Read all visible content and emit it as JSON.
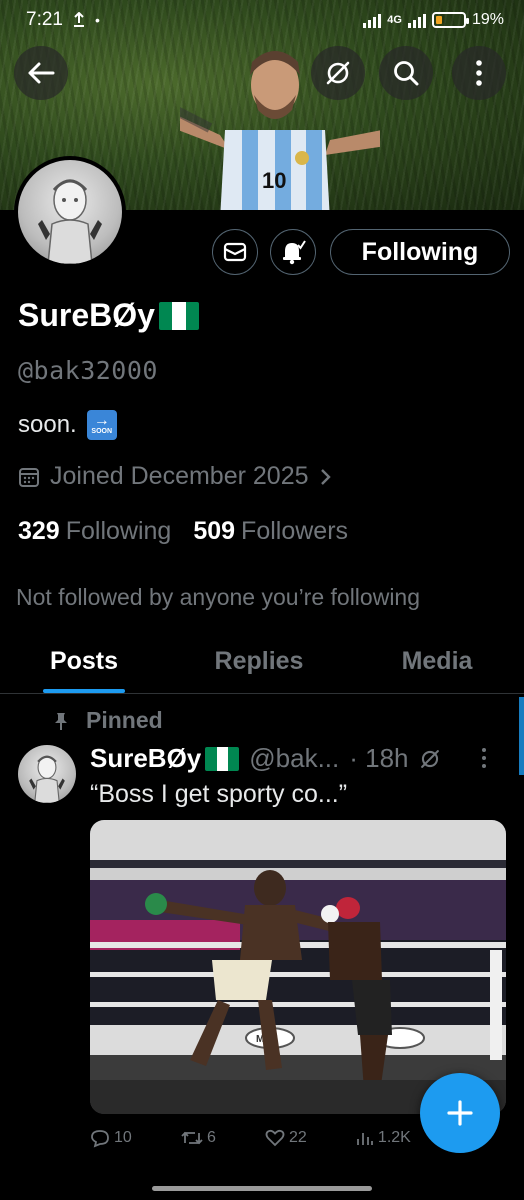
{
  "status_bar": {
    "time": "7:21",
    "network": "4G",
    "battery": "19%"
  },
  "profile": {
    "display_name": "SureBØy",
    "handle": "@bak32000",
    "bio": "soon.",
    "bio_emoji_text": "SOON",
    "joined": "Joined December 2025",
    "following_count": "329",
    "following_label": "Following",
    "followers_count": "509",
    "followers_label": "Followers",
    "mutuals_text": "Not followed by anyone you’re following",
    "follow_button_label": "Following"
  },
  "tabs": [
    {
      "label": "Posts",
      "active": true
    },
    {
      "label": "Replies",
      "active": false
    },
    {
      "label": "Media",
      "active": false
    }
  ],
  "pinned_post": {
    "pinned_label": "Pinned",
    "author_name": "SureBØy",
    "author_handle": "@bak...",
    "time": "· 18h",
    "text": "“Boss I get sporty co...”",
    "replies": "10",
    "reposts": "6",
    "likes": "22",
    "views": "1.2K",
    "banner_text": "MTN"
  },
  "colors": {
    "accent": "#1d9bf0",
    "text_secondary": "#71767b",
    "border": "#2f3336",
    "flag_green": "#008751"
  },
  "icons": [
    "back-arrow-icon",
    "grok-icon",
    "search-icon",
    "more-vertical-icon",
    "mail-icon",
    "notification-bell-icon",
    "calendar-icon",
    "chevron-right-icon",
    "pin-icon",
    "reply-icon",
    "repost-icon",
    "like-icon",
    "views-icon",
    "plus-icon"
  ]
}
